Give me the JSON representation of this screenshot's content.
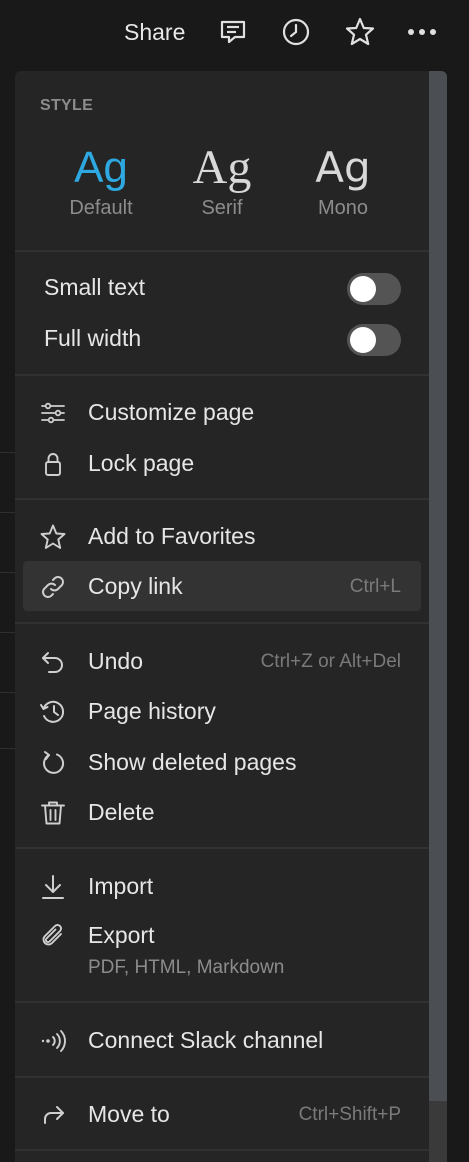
{
  "topbar": {
    "share_label": "Share",
    "icons": [
      "comment-icon",
      "clock-icon",
      "star-icon",
      "more-icon"
    ]
  },
  "menu": {
    "style_title": "STYLE",
    "fonts": [
      {
        "sample": "Ag",
        "label": "Default",
        "active": true
      },
      {
        "sample": "Ag",
        "label": "Serif",
        "active": false
      },
      {
        "sample": "Ag",
        "label": "Mono",
        "active": false
      }
    ],
    "toggles": [
      {
        "label": "Small text",
        "on": false
      },
      {
        "label": "Full width",
        "on": false
      }
    ],
    "items": {
      "customize": {
        "label": "Customize page",
        "icon": "sliders-icon"
      },
      "lock": {
        "label": "Lock page",
        "icon": "lock-icon"
      },
      "favorites": {
        "label": "Add to Favorites",
        "icon": "star-icon"
      },
      "copy_link": {
        "label": "Copy link",
        "shortcut": "Ctrl+L",
        "icon": "link-icon"
      },
      "undo": {
        "label": "Undo",
        "shortcut": "Ctrl+Z or Alt+Del",
        "icon": "undo-icon"
      },
      "history": {
        "label": "Page history",
        "icon": "history-icon"
      },
      "deleted": {
        "label": "Show deleted pages",
        "icon": "restore-icon"
      },
      "delete": {
        "label": "Delete",
        "icon": "trash-icon"
      },
      "import": {
        "label": "Import",
        "icon": "download-arrow-icon"
      },
      "export": {
        "label": "Export",
        "sublabel": "PDF, HTML, Markdown",
        "icon": "paperclip-icon"
      },
      "slack": {
        "label": "Connect Slack channel",
        "icon": "broadcast-icon"
      },
      "move": {
        "label": "Move to",
        "shortcut": "Ctrl+Shift+P",
        "icon": "share-arrow-icon"
      }
    }
  },
  "colors": {
    "background": "#191919",
    "menu_bg": "#252525",
    "accent": "#2ea8e0",
    "hover_row": "#333333"
  }
}
